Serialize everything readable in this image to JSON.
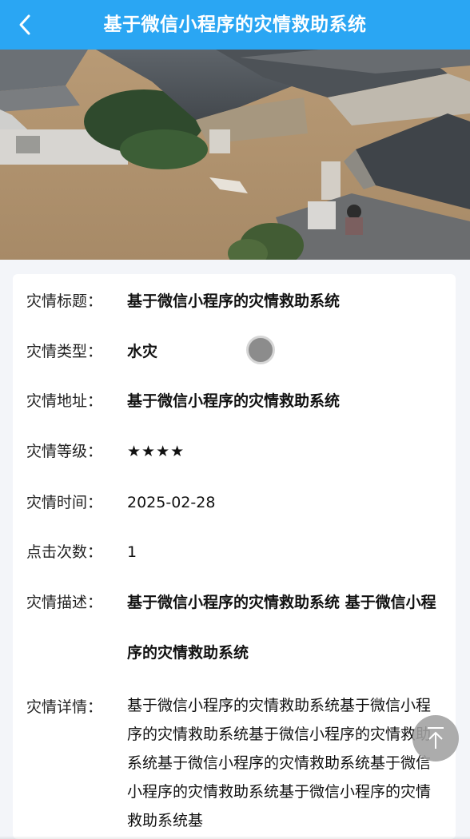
{
  "header": {
    "back_icon": "chevron-left-icon",
    "title": "基于微信小程序的灾情救助系统",
    "background": "#2aa6f3"
  },
  "hero": {
    "alt_description": ""
  },
  "details": {
    "title": {
      "label": "灾情标题：",
      "value": "基于微信小程序的灾情救助系统"
    },
    "type": {
      "label": "灾情类型：",
      "value": "水灾"
    },
    "address": {
      "label": "灾情地址：",
      "value": "基于微信小程序的灾情救助系统"
    },
    "level": {
      "label": "灾情等级：",
      "value": "★★★★",
      "star_count": 4
    },
    "time": {
      "label": "灾情时间：",
      "value": "2025-02-28"
    },
    "clicks": {
      "label": "点击次数：",
      "value": "1"
    },
    "description": {
      "label": "灾情描述：",
      "value": "基于微信小程序的灾情救助系统 基于微信小程序的灾情救助系统"
    },
    "detail": {
      "label": "灾情详情：",
      "value": "基于微信小程序的灾情救助系统基于微信小程序的灾情救助系统基于微信小程序的灾情救助系统基于微信小程序的灾情救助系统基于微信小程序的灾情救助系统基于微信小程序的灾情救助系统基"
    }
  },
  "controls": {
    "back_to_top_icon": "arrow-up-icon"
  }
}
